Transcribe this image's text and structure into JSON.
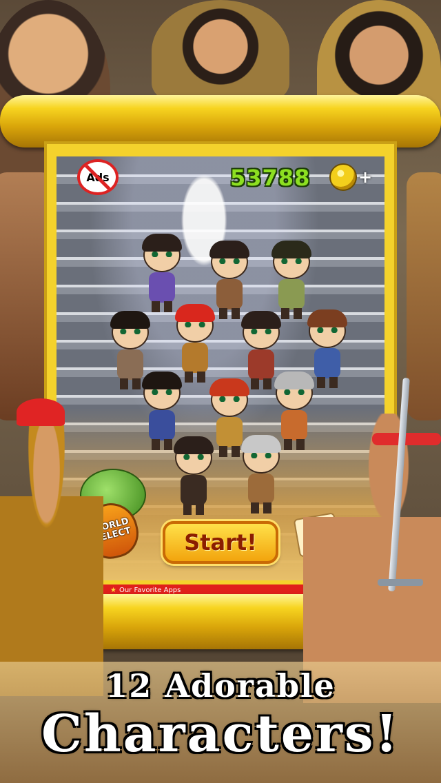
{
  "hud": {
    "ads_label": "Ads",
    "coins": "53788",
    "plus_label": "+"
  },
  "buttons": {
    "world_select_label": "WORLD SELECT",
    "start_label": "Start!"
  },
  "footer": {
    "favorites_label": "Our Favorite Apps"
  },
  "caption": {
    "line1": "12 Adorable",
    "line2": "Characters!"
  },
  "characters": [
    {
      "name": "character-1",
      "body_color": "#6a4fb0",
      "hair_color": "#2b1f1a"
    },
    {
      "name": "character-2",
      "body_color": "#8c5e3a",
      "hair_color": "#2b1f1a"
    },
    {
      "name": "character-3",
      "body_color": "#8a9a52",
      "hair_color": "#2b2a1a"
    },
    {
      "name": "character-4",
      "body_color": "#8a6d55",
      "hair_color": "#1e1611"
    },
    {
      "name": "character-5",
      "body_color": "#b47a2c",
      "hair_color": "#d9271d"
    },
    {
      "name": "character-6",
      "body_color": "#9c3a2a",
      "hair_color": "#2b1f1a"
    },
    {
      "name": "character-7",
      "body_color": "#3f5ea8",
      "hair_color": "#7b3e20"
    },
    {
      "name": "character-8",
      "body_color": "#3a4e9c",
      "hair_color": "#1e1611"
    },
    {
      "name": "character-9",
      "body_color": "#c29035",
      "hair_color": "#c9381c"
    },
    {
      "name": "character-10",
      "body_color": "#c86b2d",
      "hair_color": "#b8b8b8"
    },
    {
      "name": "character-11",
      "body_color": "#3a2b22",
      "hair_color": "#2b1f1a"
    },
    {
      "name": "character-12",
      "body_color": "#9c6b3a",
      "hair_color": "#c8c8c8"
    }
  ]
}
